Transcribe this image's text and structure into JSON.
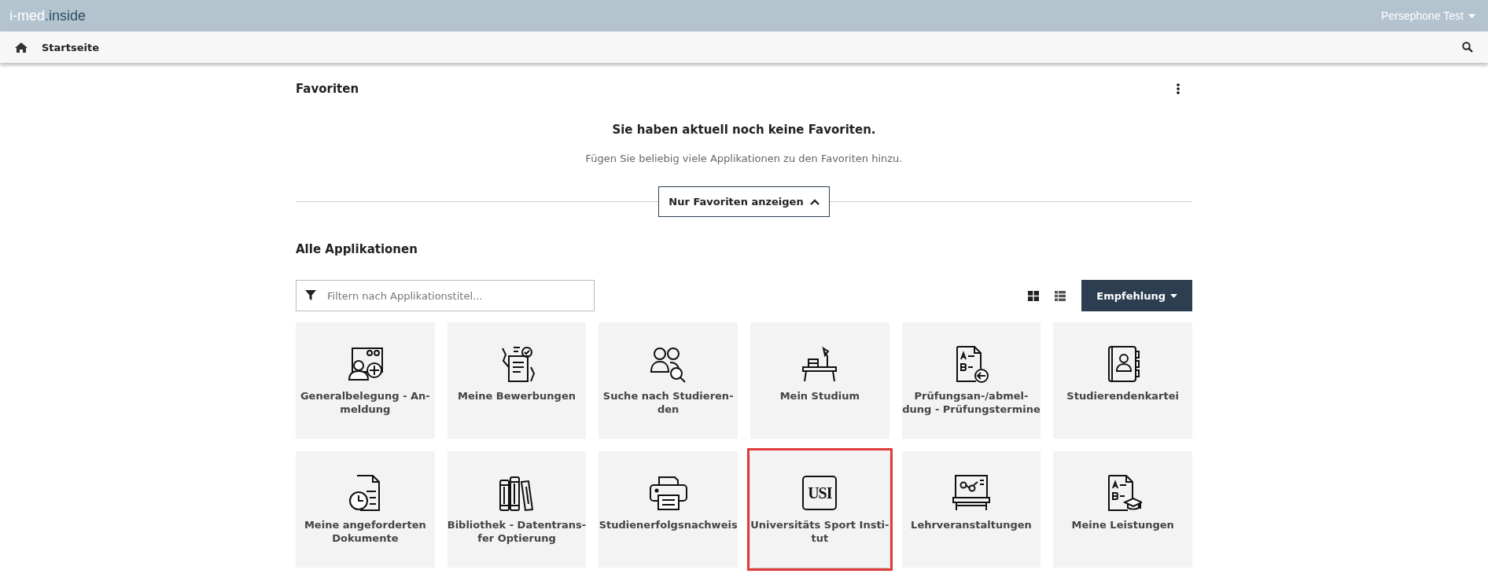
{
  "topbar": {
    "logo_main": "i-med",
    "logo_dot": ".",
    "logo_sub": "inside",
    "user": "Persephone Test"
  },
  "navbar": {
    "home": "Startseite"
  },
  "favorites": {
    "title": "Favoriten",
    "empty_title": "Sie haben aktuell noch keine Favoriten.",
    "empty_text": "Fügen Sie beliebig viele Applikationen zu den Favoriten hinzu.",
    "toggle": "Nur Favoriten anzeigen",
    "expanded": true
  },
  "applications": {
    "title": "Alle Applikationen",
    "filter": {
      "placeholder": "Filtern nach Applikationstitel..."
    },
    "views": [
      {
        "kind": "grid",
        "selected": true
      },
      {
        "kind": "list",
        "selected": false
      }
    ],
    "sort": "Empfehlung",
    "tiles": [
      {
        "kind": "person-add",
        "label": "Generalbelegung - An-\nmeldung",
        "highlighted": false
      },
      {
        "kind": "application",
        "label": "Meine Bewerbungen",
        "highlighted": false
      },
      {
        "kind": "people-search",
        "label": "Suche nach Studieren-\nden",
        "highlighted": false
      },
      {
        "kind": "desk",
        "label": "Mein Studium",
        "highlighted": false
      },
      {
        "kind": "exam-return",
        "label": "Prüfungsan-/abmel-\ndung - Prüfungstermine",
        "highlighted": false
      },
      {
        "kind": "contact-book",
        "label": "Studierendenkartei",
        "highlighted": false
      },
      {
        "kind": "document-clock",
        "label": "Meine angeforderten\nDokumente",
        "highlighted": false
      },
      {
        "kind": "books",
        "label": "Bibliothek - Datentrans-\nfer Optierung",
        "highlighted": false
      },
      {
        "kind": "printer",
        "label": "Studienerfolgsnachweis",
        "highlighted": false
      },
      {
        "kind": "logo",
        "logo_text": "USI",
        "label": "Universitäts Sport Insti-\ntut",
        "highlighted": true
      },
      {
        "kind": "board",
        "label": "Lehrveranstaltungen",
        "highlighted": false
      },
      {
        "kind": "exam-grad",
        "label": "Meine Leistungen",
        "highlighted": false
      }
    ]
  }
}
